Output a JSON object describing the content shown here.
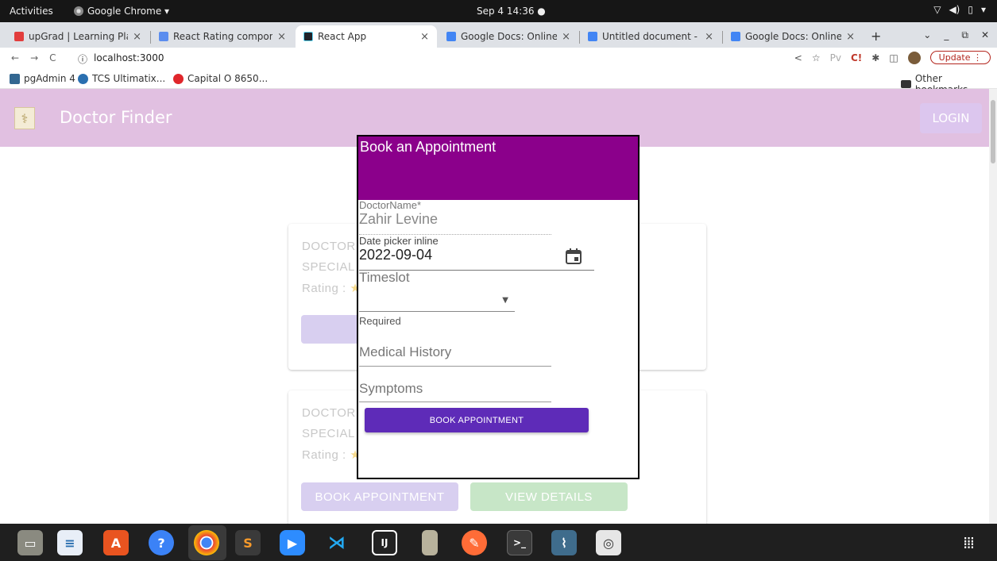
{
  "topbar": {
    "activities": "Activities",
    "app_menu": "Google Chrome ▾",
    "clock": "Sep 4  14:36  ●",
    "systray_icons": [
      "wifi-icon",
      "volume-icon",
      "battery-icon",
      "system-menu-icon"
    ]
  },
  "tabs": [
    {
      "title": "upGrad | Learning Platfo",
      "icon": "upgrad-favicon",
      "color": "#e23d3d"
    },
    {
      "title": "React Rating componen",
      "icon": "react-rating-favicon",
      "color": "#5b8def"
    },
    {
      "title": "React App",
      "icon": "react-favicon",
      "color": "#20232a",
      "active": true
    },
    {
      "title": "Google Docs: Online Do",
      "icon": "google-favicon",
      "color": "#4285f4"
    },
    {
      "title": "Untitled document - Goo",
      "icon": "docs-favicon",
      "color": "#4285f4"
    },
    {
      "title": "Google Docs: Online Do",
      "icon": "google-favicon",
      "color": "#4285f4"
    }
  ],
  "tab_close": "×",
  "new_tab": "+",
  "address": {
    "back": "←",
    "forward": "→",
    "reload": "C",
    "info": "ⓘ",
    "url": "localhost:3000",
    "update_label": "Update",
    "menu": "⋮"
  },
  "bookmarks": [
    {
      "label": "pgAdmin 4",
      "color": "#336791"
    },
    {
      "label": "TCS Ultimatix...",
      "color": "#2a6fb0"
    },
    {
      "label": "Capital O 8650...",
      "color": "#e0262b"
    }
  ],
  "other_bookmarks": "Other bookmarks",
  "app": {
    "title": "Doctor Finder",
    "login": "LOGIN"
  },
  "cards": [
    {
      "doctor": "DOCTOR",
      "specialty": "SPECIAL",
      "rating": "Rating :",
      "book": "BOOK A"
    },
    {
      "doctor": "DOCTOR",
      "specialty": "SPECIAL",
      "rating": "Rating :",
      "book": "BOOK APPOINTMENT",
      "details": "VIEW DETAILS"
    }
  ],
  "modal": {
    "title": "Book an Appointment",
    "doctor_label": "DoctorName*",
    "doctor_value": "Zahir Levine",
    "date_label": "Date picker inline",
    "date_value": "2022-09-04",
    "timeslot_label": "Timeslot",
    "timeslot_helper": "Required",
    "history_placeholder": "Medical History",
    "symptoms_placeholder": "Symptoms",
    "book_button": "BOOK APPOINTMENT"
  },
  "colors": {
    "appbar": "#e1c0e1",
    "modal_header": "#8b008b",
    "book_button": "#5e2bb8"
  },
  "dock": [
    "files-icon",
    "writer-icon",
    "software-icon",
    "help-icon",
    "chrome-icon",
    "sublime-icon",
    "zoom-icon",
    "vscode-icon",
    "intellij-icon",
    "archive-icon",
    "postman-icon",
    "terminal-icon",
    "mysql-workbench-icon",
    "screenshot-icon"
  ]
}
